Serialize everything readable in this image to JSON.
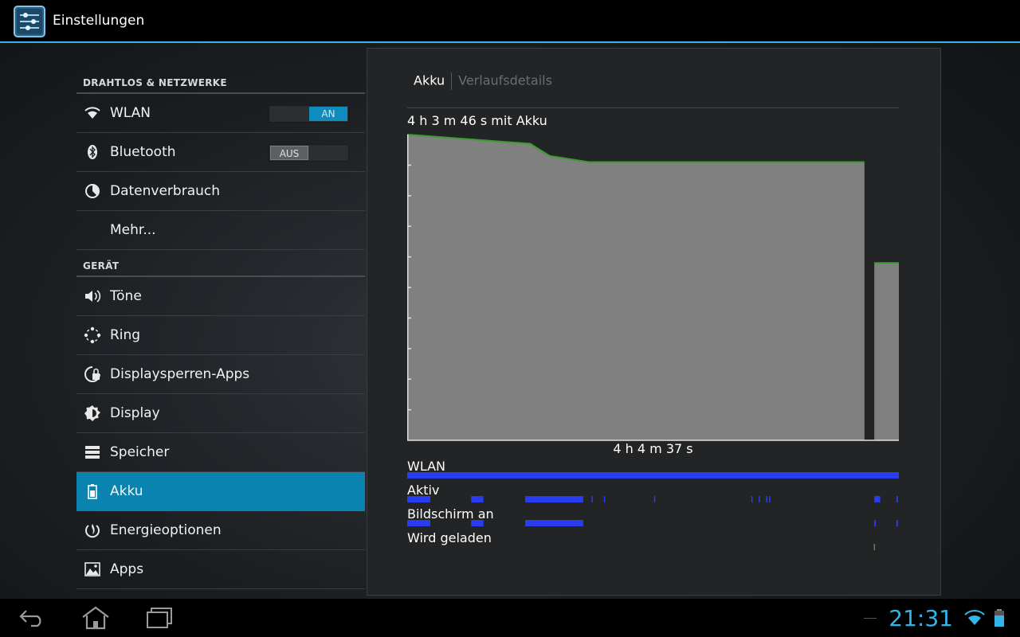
{
  "app": {
    "title": "Einstellungen",
    "icon": "settings-sliders-icon"
  },
  "sections": {
    "wireless": "DRAHTLOS & NETZWERKE",
    "device": "GERÄT"
  },
  "items": {
    "wlan": {
      "label": "WLAN",
      "icon": "wifi-icon",
      "toggle": "AN"
    },
    "bluetooth": {
      "label": "Bluetooth",
      "icon": "bluetooth-icon",
      "toggle": "AUS"
    },
    "data": {
      "label": "Datenverbrauch",
      "icon": "data-usage-icon"
    },
    "more": {
      "label": "Mehr..."
    },
    "sound": {
      "label": "Töne",
      "icon": "speaker-icon"
    },
    "ring": {
      "label": "Ring",
      "icon": "ring-icon"
    },
    "lockscreen": {
      "label": "Displaysperren-Apps",
      "icon": "lock-icon"
    },
    "display": {
      "label": "Display",
      "icon": "brightness-icon"
    },
    "storage": {
      "label": "Speicher",
      "icon": "storage-icon"
    },
    "battery": {
      "label": "Akku",
      "icon": "battery-icon",
      "selected": true
    },
    "power": {
      "label": "Energieoptionen",
      "icon": "power-icon"
    },
    "apps": {
      "label": "Apps",
      "icon": "apps-icon"
    }
  },
  "panel": {
    "tab_active": "Akku",
    "tab_inactive": "Verlaufsdetails",
    "duration_on_battery": "4 h 3 m 46 s mit Akku",
    "total_time": "4 h 4 m 37 s",
    "tracks": {
      "wlan": "WLAN",
      "active": "Aktiv",
      "screen_on": "Bildschirm an",
      "charging": "Wird geladen"
    }
  },
  "chart_data": {
    "type": "area",
    "ylim": [
      0,
      100
    ],
    "grid": false,
    "series": [
      {
        "x": [
          0,
          0.25,
          0.29,
          0.37,
          0.93
        ],
        "values": [
          100,
          97,
          93,
          91,
          91
        ]
      },
      {
        "x": [
          0.95,
          1.0
        ],
        "values": [
          58,
          58
        ]
      }
    ],
    "tracks": {
      "wlan": [
        [
          0,
          1.0
        ]
      ],
      "active": [
        [
          0,
          0.047
        ],
        [
          0.13,
          0.155
        ],
        [
          0.24,
          0.358
        ],
        [
          0.375,
          0.377
        ],
        [
          0.4,
          0.402
        ],
        [
          0.502,
          0.504
        ],
        [
          0.7,
          0.702
        ],
        [
          0.715,
          0.717
        ],
        [
          0.73,
          0.732
        ],
        [
          0.736,
          0.738
        ],
        [
          0.95,
          0.962
        ],
        [
          0.995,
          0.998
        ]
      ],
      "screen_on": [
        [
          0,
          0.047
        ],
        [
          0.13,
          0.155
        ],
        [
          0.24,
          0.358
        ],
        [
          0.95,
          0.953
        ],
        [
          0.995,
          0.998
        ]
      ],
      "charging": [
        [
          0.949,
          0.951
        ]
      ]
    },
    "colors": {
      "fill": "#808080",
      "line": "#3a9d2e",
      "track": "#2a3cf0",
      "charge": "#3a9d2e"
    }
  },
  "status": {
    "clock": "21:31"
  },
  "nav": {
    "back": "back-icon",
    "home": "home-icon",
    "recents": "recent-apps-icon"
  }
}
